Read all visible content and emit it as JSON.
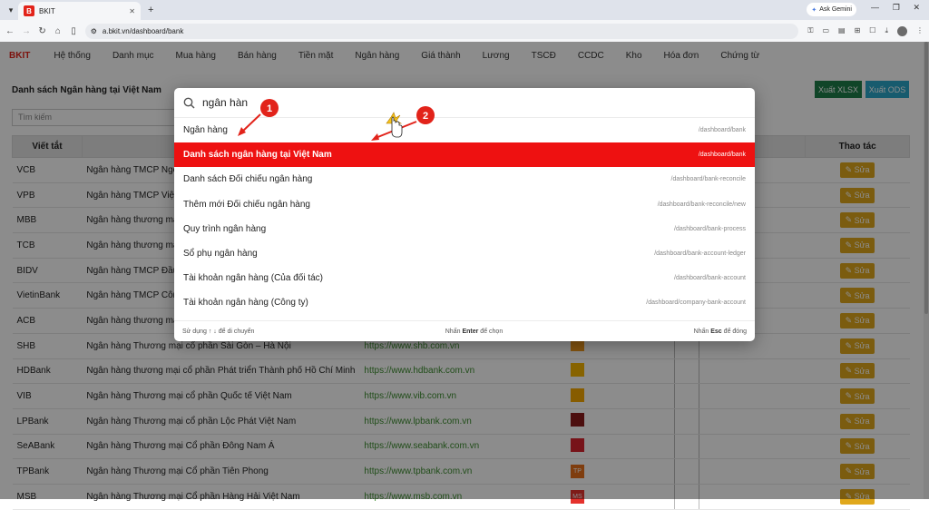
{
  "browser": {
    "tab_title": "BKIT",
    "favicon_letter": "B",
    "url": "a.bkit.vn/dashboard/bank",
    "gemini_label": "Ask Gemini"
  },
  "app": {
    "brand": "BKIT",
    "menu": [
      "Hệ thống",
      "Danh mục",
      "Mua hàng",
      "Bán hàng",
      "Tiền mặt",
      "Ngân hàng",
      "Giá thành",
      "Lương",
      "TSCĐ",
      "CCDC",
      "Kho",
      "Hóa đơn",
      "Chứng từ"
    ],
    "page_title": "Danh sách Ngân hàng tại Việt Nam",
    "export_xlsx": "Xuất XLSX",
    "export_ods": "Xuất ODS",
    "search_placeholder": "Tìm kiếm",
    "table_headers": {
      "abbr": "Viết tắt",
      "actions": "Thao tác"
    },
    "edit_label": "Sửa",
    "rows": [
      {
        "abbr": "VCB",
        "name": "Ngân hàng TMCP Ngo",
        "web": ""
      },
      {
        "abbr": "VPB",
        "name": "Ngân hàng TMCP Việt",
        "web": ""
      },
      {
        "abbr": "MBB",
        "name": "Ngân hàng thương mạ",
        "web": ""
      },
      {
        "abbr": "TCB",
        "name": "Ngân hàng thương mạ",
        "web": ""
      },
      {
        "abbr": "BIDV",
        "name": "Ngân hàng TMCP Đầu",
        "web": ""
      },
      {
        "abbr": "VietinBank",
        "name": "Ngân hàng TMCP Công",
        "web": ""
      },
      {
        "abbr": "ACB",
        "name": "Ngân hàng thương mạ",
        "web": ""
      },
      {
        "abbr": "SHB",
        "name": "Ngân hàng Thương mại cổ phần Sài Gòn – Hà Nội",
        "web": "https://www.shb.com.vn"
      },
      {
        "abbr": "HDBank",
        "name": "Ngân hàng thương mại cổ phần Phát triển Thành phố Hồ Chí Minh",
        "web": "https://www.hdbank.com.vn"
      },
      {
        "abbr": "VIB",
        "name": "Ngân hàng Thương mại cổ phần Quốc tế Việt Nam",
        "web": "https://www.vib.com.vn"
      },
      {
        "abbr": "LPBank",
        "name": "Ngân hàng Thương mại cổ phần Lộc Phát Việt Nam",
        "web": "https://www.lpbank.com.vn"
      },
      {
        "abbr": "SeABank",
        "name": "Ngân hàng Thương mại Cổ phần Đông Nam Á",
        "web": "https://www.seabank.com.vn"
      },
      {
        "abbr": "TPBank",
        "name": "Ngân hàng Thương mại Cổ phần Tiên Phong",
        "web": "https://www.tpbank.com.vn"
      },
      {
        "abbr": "MSB",
        "name": "Ngân hàng Thương mại Cổ phần Hàng Hải Việt Nam",
        "web": "https://www.msb.com.vn"
      }
    ]
  },
  "palette": {
    "query": "ngân hàn",
    "items": [
      {
        "label": "Ngân hàng",
        "path": "/dashboard/bank"
      },
      {
        "label": "Danh sách ngân hàng tại Việt Nam",
        "path": "/dashboard/bank",
        "active": true
      },
      {
        "label": "Danh sách Đối chiếu ngân hàng",
        "path": "/dashboard/bank-reconcile"
      },
      {
        "label": "Thêm mới Đối chiếu ngân hàng",
        "path": "/dashboard/bank-reconcile/new"
      },
      {
        "label": "Quy trình ngân hàng",
        "path": "/dashboard/bank-process"
      },
      {
        "label": "Sổ phụ ngân hàng",
        "path": "/dashboard/bank-account-ledger"
      },
      {
        "label": "Tài khoản ngân hàng (Của đối tác)",
        "path": "/dashboard/bank-account"
      },
      {
        "label": "Tài khoản ngân hàng (Công ty)",
        "path": "/dashboard/company-bank-account"
      }
    ],
    "footer_move": "Sử dụng ↑ ↓ để di chuyển",
    "footer_enter_pre": "Nhấn",
    "footer_enter_key": "Enter",
    "footer_enter_post": "để chọn",
    "footer_esc_pre": "Nhấn",
    "footer_esc_key": "Esc",
    "footer_esc_post": "để đóng"
  },
  "annotations": [
    "1",
    "2"
  ],
  "colors": {
    "brand": "#e2231a",
    "active_row": "#ee1111",
    "edit": "#e0a81c",
    "xlsx": "#1e7e4a",
    "ods": "#2aa7c9"
  }
}
